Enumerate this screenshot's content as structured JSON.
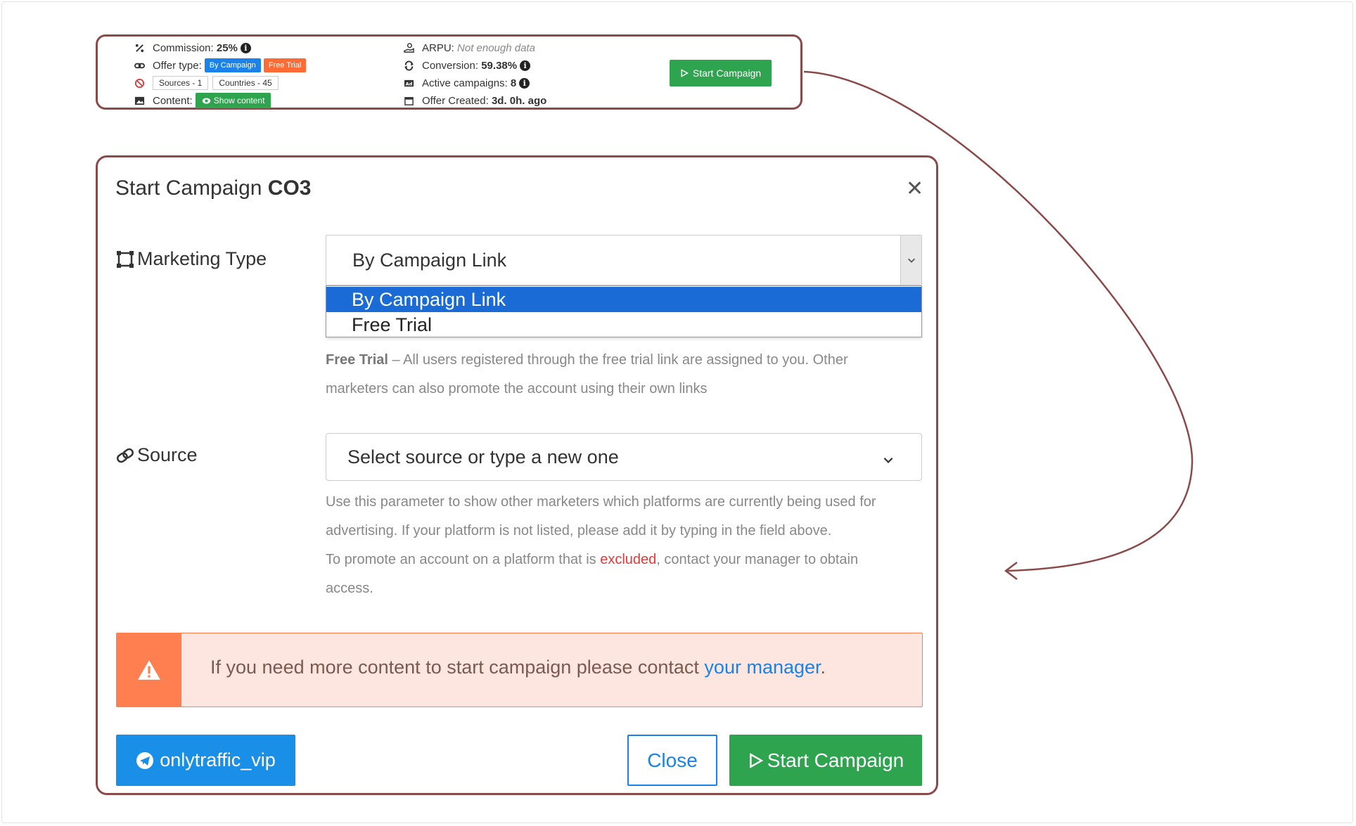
{
  "offer": {
    "commission_label": "Commission:",
    "commission_value": "25%",
    "offer_type_label": "Offer type:",
    "offer_type_badges": [
      "By Campaign",
      "Free Trial"
    ],
    "sources_chip": "Sources - 1",
    "countries_chip": "Countries - 45",
    "content_label": "Content:",
    "show_content_label": "Show content",
    "arpu_label": "ARPU:",
    "arpu_value": "Not enough data",
    "conversion_label": "Conversion:",
    "conversion_value": "59.38%",
    "active_campaigns_label": "Active campaigns:",
    "active_campaigns_value": "8",
    "offer_created_label": "Offer Created:",
    "offer_created_value": "3d. 0h. ago",
    "info_glyph": "i",
    "start_campaign_label": "Start Campaign"
  },
  "modal": {
    "title_prefix": "Start Campaign",
    "title_code": "CO3",
    "close_glyph": "✕",
    "marketing_type": {
      "label": "Marketing Type",
      "selected": "By Campaign Link",
      "options": [
        "By Campaign Link",
        "Free Trial"
      ],
      "help_bold": "Free Trial",
      "help_line1": " – All users registered through the free trial link are assigned to you. Other",
      "help_line2": "marketers can also promote the account using their own links"
    },
    "source": {
      "label": "Source",
      "placeholder": "Select source or type a new one",
      "help_line1": "Use this parameter to show other marketers which platforms are currently being used for",
      "help_line2": "advertising. If your platform is not listed, please add it by typing in the field above.",
      "help_line3_pre": "To promote an account on a platform that is ",
      "help_line3_red": "excluded",
      "help_line3_post": ", contact your manager to obtain",
      "help_line4": "access."
    },
    "alert": {
      "text": "If you need more content to start campaign please contact ",
      "link": "your manager",
      "suffix": "."
    },
    "telegram_button": "onlytraffic_vip",
    "close_button": "Close",
    "start_button": "Start Campaign"
  },
  "colors": {
    "accent_green": "#2ea44f",
    "accent_blue": "#1a82e8",
    "alert_orange": "#ff7f50",
    "highlight_border": "#8b4a4a",
    "danger_red": "#e03b3b"
  }
}
